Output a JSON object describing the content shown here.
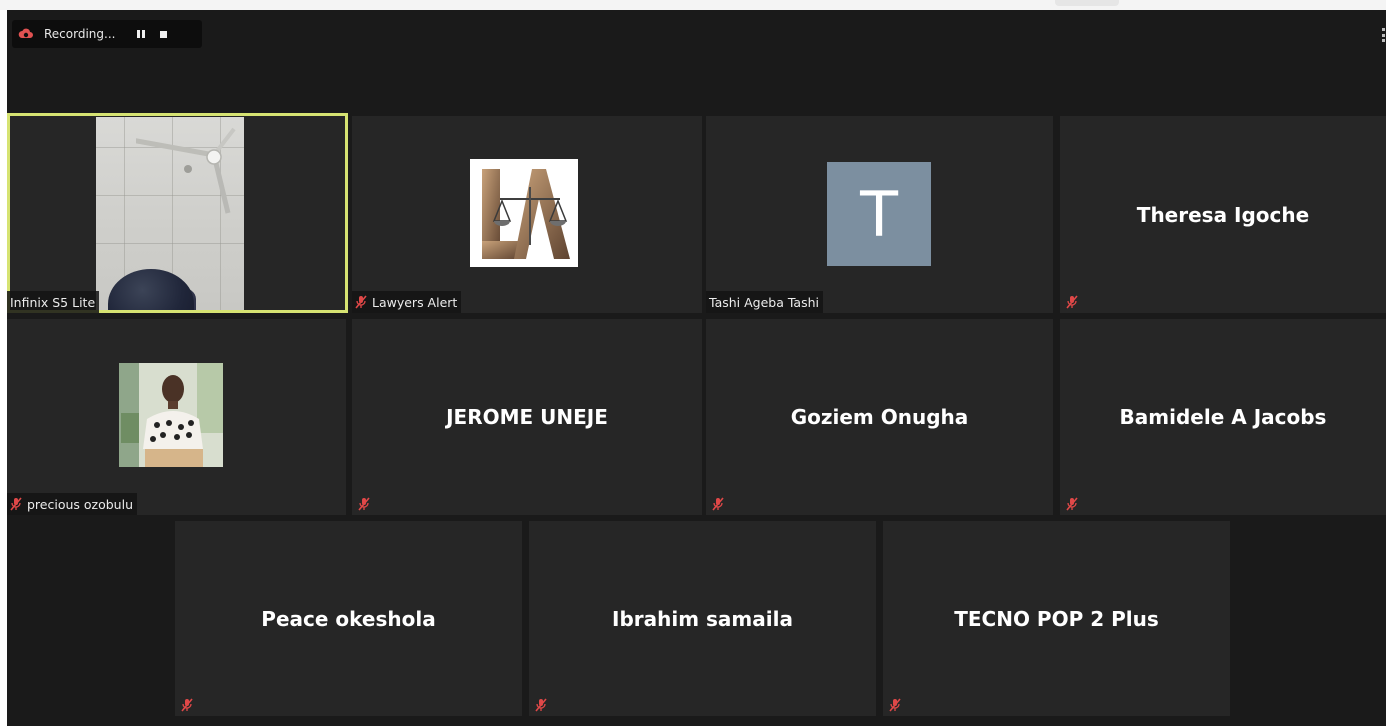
{
  "recording": {
    "label": "Recording...",
    "pause_icon": "pause-icon",
    "stop_icon": "stop-icon",
    "status_icon": "cloud-record-icon",
    "status_color": "#e05252"
  },
  "toolbar": {
    "more_icon": "more-options-icon"
  },
  "colors": {
    "background": "#1a1a1a",
    "tile": "#262626",
    "active_speaker_border": "#d6e372",
    "muted": "#e04848",
    "avatar_t": "#7c8fa0"
  },
  "participants": [
    {
      "caption": "Infinix S5 Lite",
      "muted": false,
      "video": true,
      "active_speaker": true
    },
    {
      "caption": "Lawyers Alert",
      "muted": true,
      "avatar": "LA",
      "avatar_type": "logo"
    },
    {
      "caption": "Tashi Ageba Tashi",
      "muted": false,
      "avatar": "T",
      "avatar_type": "initial"
    },
    {
      "display_name": "Theresa Igoche",
      "muted": true
    },
    {
      "caption": "precious ozobulu",
      "muted": true,
      "avatar_type": "photo"
    },
    {
      "display_name": "JEROME UNEJE",
      "muted": true
    },
    {
      "display_name": "Goziem Onugha",
      "muted": true
    },
    {
      "display_name": "Bamidele A Jacobs",
      "muted": true
    },
    {
      "display_name": "Peace okeshola",
      "muted": true
    },
    {
      "display_name": "Ibrahim samaila",
      "muted": true
    },
    {
      "display_name": "TECNO POP 2 Plus",
      "muted": true
    }
  ]
}
